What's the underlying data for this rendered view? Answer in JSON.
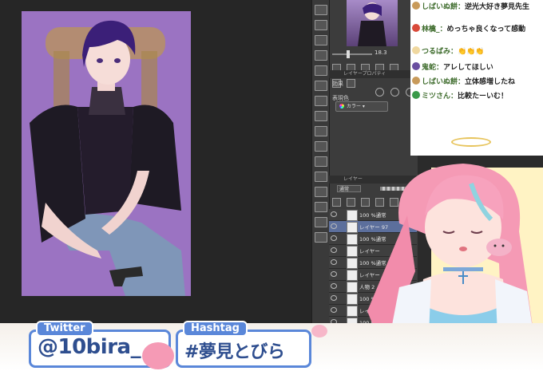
{
  "panel": {
    "zoom_value": "18.3",
    "layer_property_header": "レイヤープロパティ",
    "effect_label": "効果",
    "expression_color_label": "表現色",
    "color_select_value": "カラー",
    "layer_header": "レイヤー",
    "blend_mode": "通常",
    "opacity": "100"
  },
  "layers": [
    {
      "name": "100 %通常",
      "selected": false
    },
    {
      "name": "レイヤー 97",
      "selected": true
    },
    {
      "name": "100 %通常",
      "selected": false
    },
    {
      "name": "レイヤー",
      "selected": false
    },
    {
      "name": "100 %通常",
      "selected": false
    },
    {
      "name": "レイヤー",
      "selected": false
    },
    {
      "name": "人物 2",
      "selected": false
    },
    {
      "name": "100 %通常",
      "selected": false
    },
    {
      "name": "レイヤー 2",
      "selected": false
    },
    {
      "name": "100 %通常",
      "selected": false
    }
  ],
  "chat": {
    "messages": [
      {
        "name": "しばいぬ餅：",
        "text": "逆光大好き夢見先生",
        "avatar_color": "#c89a5a"
      },
      {
        "name": "林檎_：",
        "text": "めっちゃ良くなって感動",
        "avatar_color": "#d94a3a"
      },
      {
        "name": "つるばみ：",
        "text": "👏👏👏",
        "avatar_color": "#f0d8a0"
      },
      {
        "name": "鬼蛇：",
        "text": "アレしてほしい",
        "avatar_color": "#6a4fa0"
      },
      {
        "name": "しばいぬ餅：",
        "text": "立体感増したね",
        "avatar_color": "#c89a5a"
      },
      {
        "name": "ミツさん：",
        "text": "比較たーいむ！",
        "avatar_color": "#3a9a4a"
      }
    ]
  },
  "overlay": {
    "twitter_label": "Twitter",
    "twitter_handle": "@10bira_",
    "hashtag_label": "Hashtag",
    "hashtag_value": "#夢見とびら"
  },
  "colors": {
    "accent_blue": "#5a87d9",
    "handle_text": "#2e4e8f",
    "layer_selected": "#5c6f9c"
  }
}
